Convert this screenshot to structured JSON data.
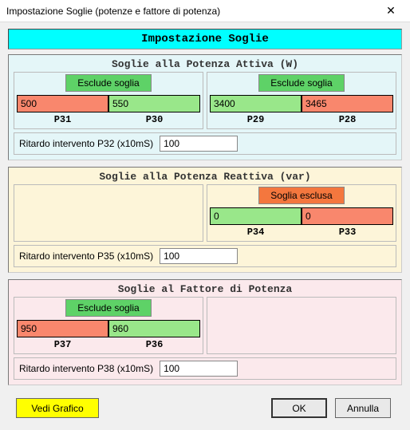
{
  "window": {
    "title": "Impostazione Soglie (potenze e fattore di potenza)"
  },
  "header": "Impostazione Soglie",
  "active": {
    "title": "Soglie alla Potenza Attiva (W)",
    "left": {
      "exclude": "Esclude soglia",
      "v1": "500",
      "v2": "550",
      "p1": "P31",
      "p2": "P30"
    },
    "right": {
      "exclude": "Esclude soglia",
      "v1": "3400",
      "v2": "3465",
      "p1": "P29",
      "p2": "P28"
    },
    "delay_label": "Ritardo intervento P32 (x10mS)",
    "delay_value": "100"
  },
  "reactive": {
    "title": "Soglie alla Potenza Reattiva (var)",
    "right": {
      "exclude": "Soglia esclusa",
      "v1": "0",
      "v2": "0",
      "p1": "P34",
      "p2": "P33"
    },
    "delay_label": "Ritardo intervento P35 (x10mS)",
    "delay_value": "100"
  },
  "pf": {
    "title": "Soglie al Fattore di Potenza",
    "left": {
      "exclude": "Esclude soglia",
      "v1": "950",
      "v2": "960",
      "p1": "P37",
      "p2": "P36"
    },
    "delay_label": "Ritardo intervento P38 (x10mS)",
    "delay_value": "100"
  },
  "footer": {
    "graph": "Vedi Grafico",
    "ok": "OK",
    "cancel": "Annulla"
  }
}
